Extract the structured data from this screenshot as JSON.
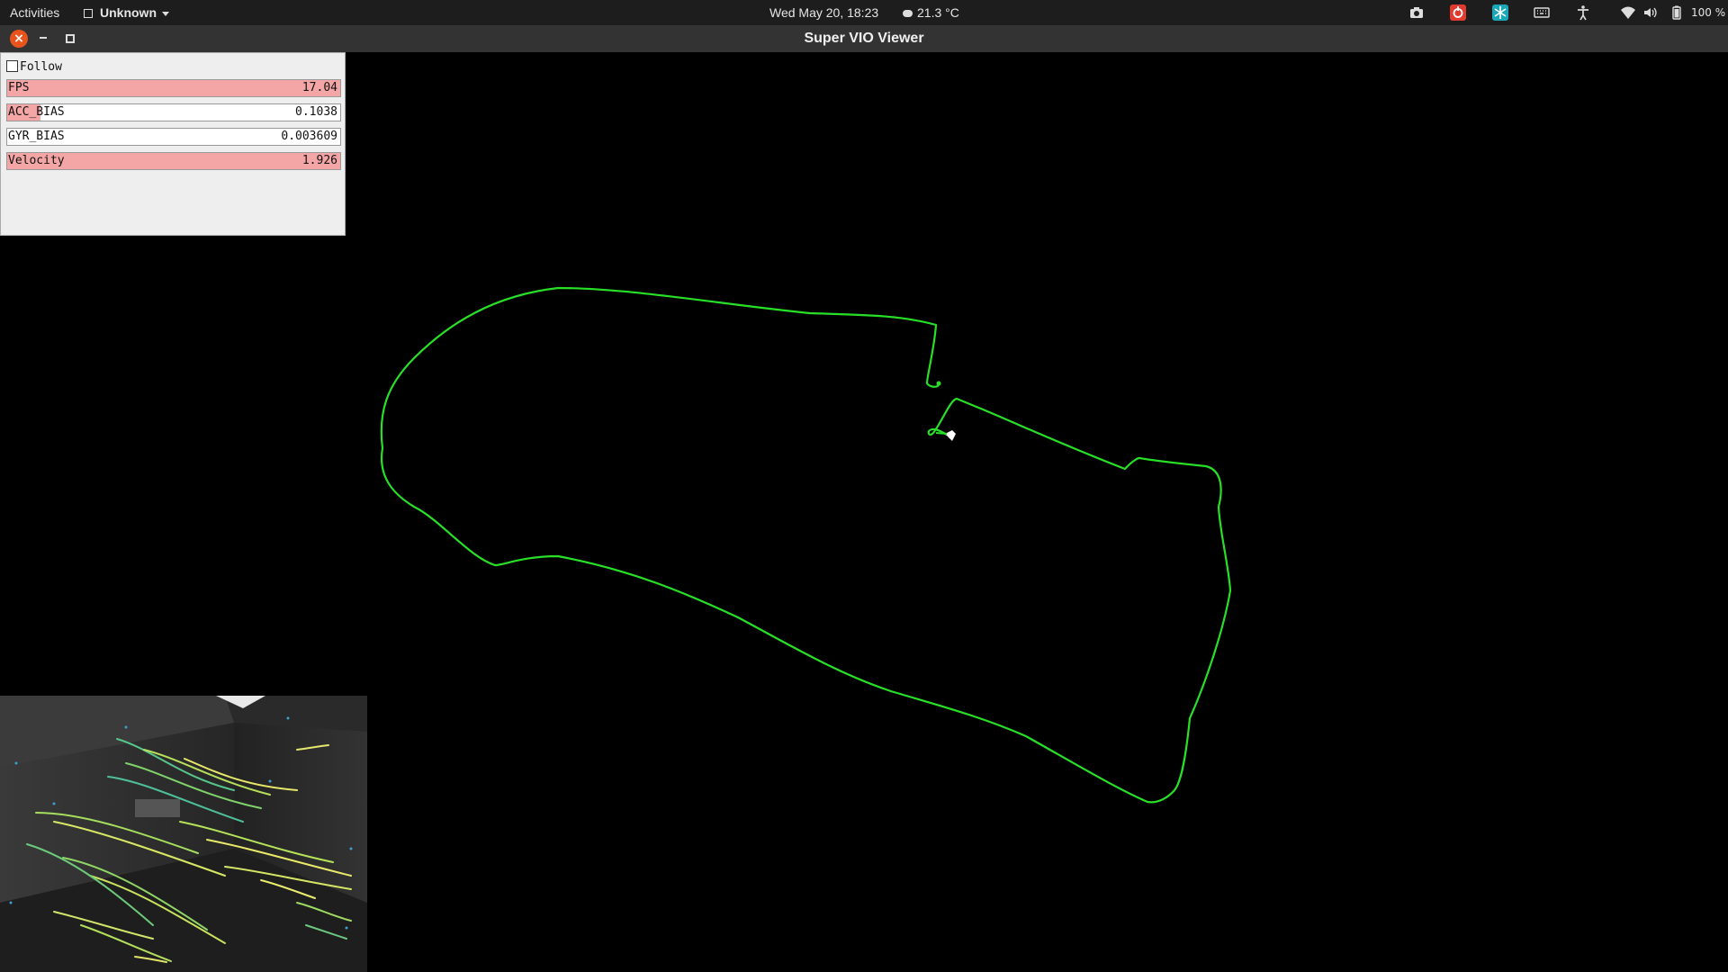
{
  "topbar": {
    "activities": "Activities",
    "app_menu": "Unknown",
    "clock": "Wed May 20, 18:23",
    "weather": "21.3 °C",
    "battery": "100 %",
    "tray_icons": [
      "screenshot-icon",
      "netease-music-icon",
      "snowflake-app-icon",
      "keyboard-icon",
      "accessibility-icon",
      "wifi-icon",
      "volume-icon",
      "battery-icon"
    ]
  },
  "window": {
    "title": "Super VIO Viewer"
  },
  "panel": {
    "follow_label": "Follow",
    "follow_checked": false,
    "rows": [
      {
        "label": "FPS",
        "value": "17.04",
        "fill": 1.0
      },
      {
        "label": "ACC_BIAS",
        "value": "0.1038",
        "fill": 0.1
      },
      {
        "label": "GYR_BIAS",
        "value": "0.003609",
        "fill": 0.0
      },
      {
        "label": "Velocity",
        "value": "1.926",
        "fill": 1.0
      }
    ]
  },
  "colors": {
    "trajectory": "#27e027",
    "panel_fill": "#f4a6a6",
    "close_button": "#e9541d"
  }
}
